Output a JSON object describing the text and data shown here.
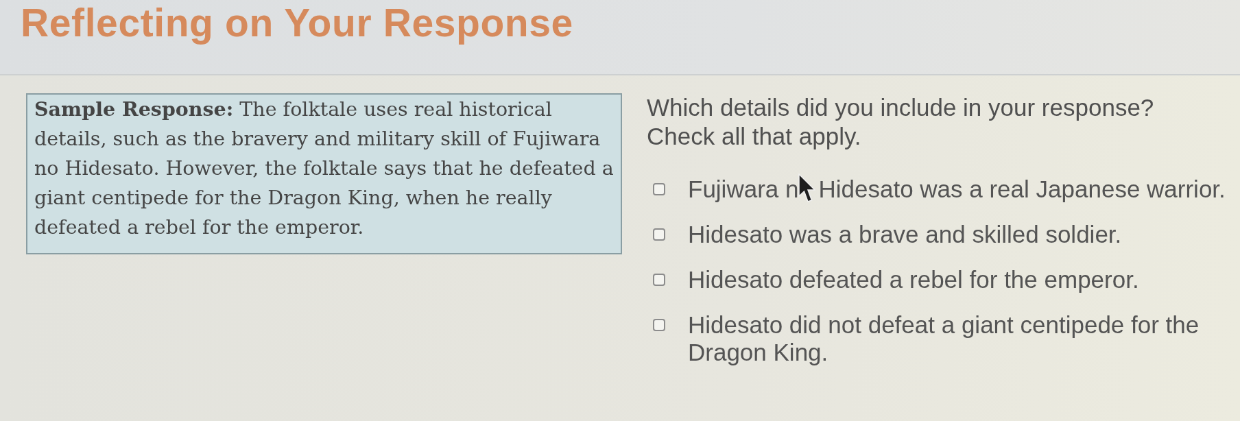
{
  "header": {
    "title": "Reflecting on Your Response"
  },
  "sample_response": {
    "text": "**Sample Response:** The folktale uses real historical details, such as the bravery and military skill of Fujiwara no Hidesato. However, the folktale says that he defeated a giant centipede for the Dragon King, when he really defeated a rebel for the emperor."
  },
  "question": {
    "prompt": "Which details did you include in your response?",
    "instruction": "Check all that apply."
  },
  "options": [
    {
      "label": "Fujiwara n",
      "after_pointer": "Hidesato was a real Japanese warrior.",
      "checked": false
    },
    {
      "label": "Hidesato was a brave and skilled soldier.",
      "checked": false
    },
    {
      "label": "Hidesato defeated a rebel for the emperor.",
      "checked": false
    },
    {
      "label": "Hidesato did not defeat a giant centipede for the Dragon King.",
      "checked": false
    }
  ]
}
